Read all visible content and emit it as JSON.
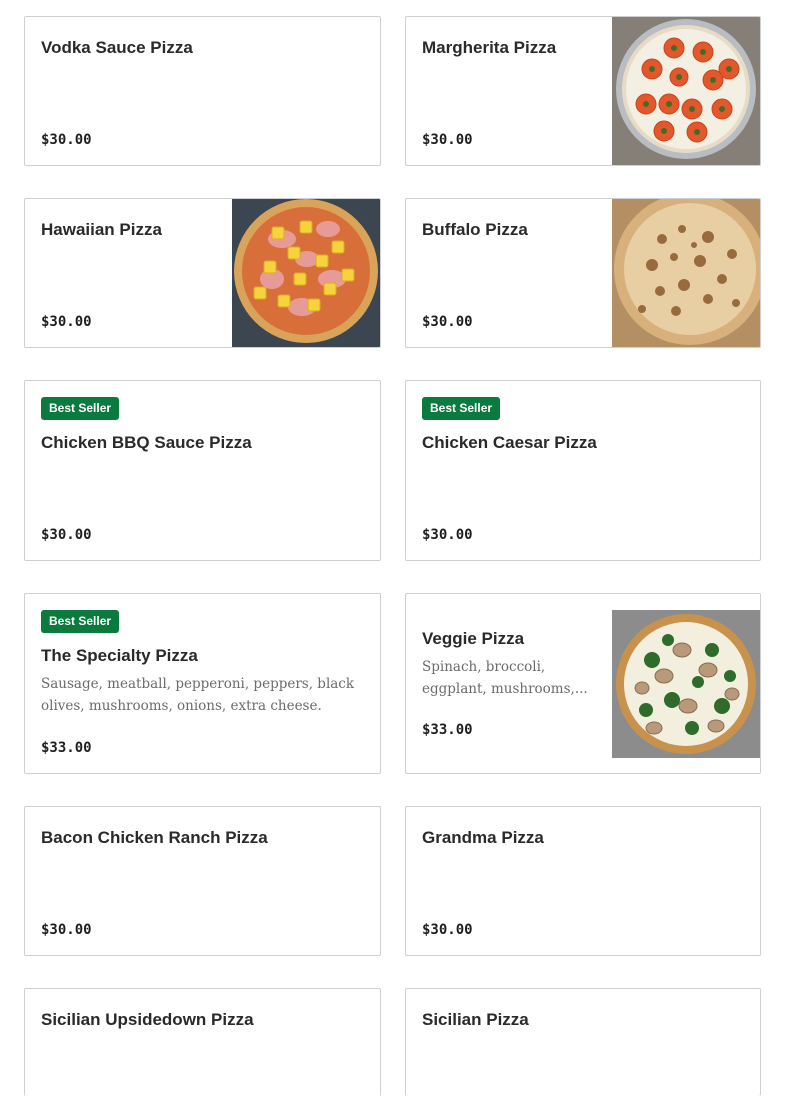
{
  "badge_text": "Best Seller",
  "brand_color": "#0b7a3e",
  "items": [
    {
      "name": "Vodka Sauce Pizza",
      "price": "$30.00"
    },
    {
      "name": "Margherita Pizza",
      "price": "$30.00",
      "image": "margherita-pizza-image"
    },
    {
      "name": "Hawaiian Pizza",
      "price": "$30.00",
      "image": "hawaiian-pizza-image"
    },
    {
      "name": "Buffalo Pizza",
      "price": "$30.00",
      "image": "buffalo-pizza-image"
    },
    {
      "name": "Chicken BBQ Sauce Pizza",
      "price": "$30.00",
      "badge": "Best Seller"
    },
    {
      "name": "Chicken Caesar Pizza",
      "price": "$30.00",
      "badge": "Best Seller"
    },
    {
      "name": "The Specialty Pizza",
      "price": "$33.00",
      "badge": "Best Seller",
      "description": "Sausage, meatball, pepperoni, peppers, black olives, mushrooms, onions, extra cheese."
    },
    {
      "name": "Veggie Pizza",
      "price": "$33.00",
      "description": "Spinach, broccoli, eggplant, mushrooms,...",
      "image": "veggie-pizza-image"
    },
    {
      "name": "Bacon Chicken Ranch Pizza",
      "price": "$30.00"
    },
    {
      "name": "Grandma Pizza",
      "price": "$30.00"
    },
    {
      "name": "Sicilian Upsidedown Pizza",
      "price": ""
    },
    {
      "name": "Sicilian Pizza",
      "price": ""
    }
  ]
}
